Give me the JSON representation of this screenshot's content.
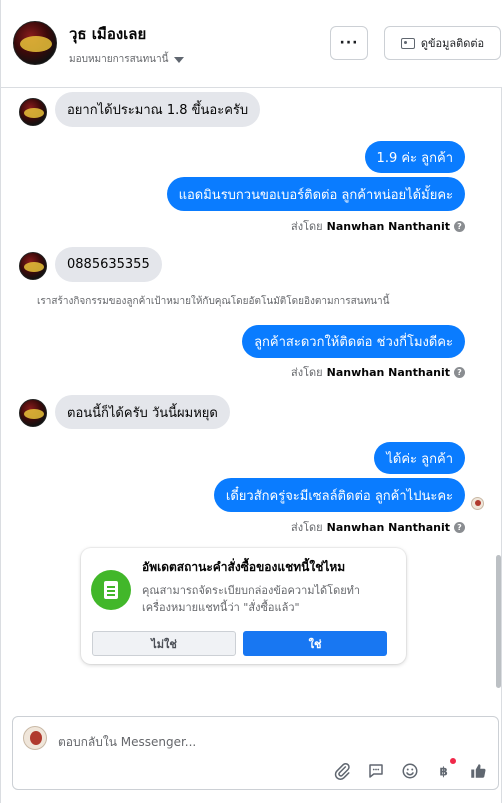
{
  "header": {
    "contact_name": "วุธ เมืองเลย",
    "assign_label": "มอบหมายการสนทนานี้",
    "more_label": "···",
    "contact_info_label": "ดูข้อมูลติดต่อ"
  },
  "messages": {
    "m1": "อยากได้ประมาณ 1.8 ขึ้นอะครับ",
    "m2": "1.9 ค่ะ ลูกค้า",
    "m3": "แอดมินรบกวนขอเบอร์ติดต่อ ลูกค้าหน่อยได้มั้ยคะ",
    "sent_prefix": "ส่งโดย",
    "sender_name": "Nanwhan Nanthanit",
    "m4": "0885635355",
    "system_note": "เราสร้างกิจกรรมของลูกค้าเป้าหมายให้กับคุณโดยอัตโนมัติโดยอิงตามการสนทนานี้",
    "m5": "ลูกค้าสะดวกให้ติดต่อ ช่วงกี่โมงดีคะ",
    "m6": "ตอนนี้ก็ได้ครับ วันนี้ผมหยุด",
    "m7": "ได้ค่ะ ลูกค้า",
    "m8": "เดี๋ยวสักครู่จะมีเซลล์ติดต่อ ลูกค้าไปนะคะ"
  },
  "status_card": {
    "title": "อัพเดตสถานะคำสั่งซื้อของแชทนี้ใช่ไหม",
    "description": "คุณสามารถจัดระเบียบกล่องข้อความได้โดยทำเครื่องหมายแชทนี้ว่า \"สั่งซื้อแล้ว\"",
    "no_label": "ไม่ใช่",
    "yes_label": "ใช่"
  },
  "composer": {
    "placeholder": "ตอบกลับใน Messenger...",
    "icons": [
      "paperclip-icon",
      "saved-reply-icon",
      "emoji-icon",
      "baht-payment-icon",
      "thumbs-up-icon"
    ]
  },
  "colors": {
    "outgoing_bubble": "#0a7cff",
    "incoming_bubble": "#e4e6eb",
    "primary_button": "#1877f2",
    "status_icon": "#42b72a",
    "notification_dot": "#f02849"
  }
}
